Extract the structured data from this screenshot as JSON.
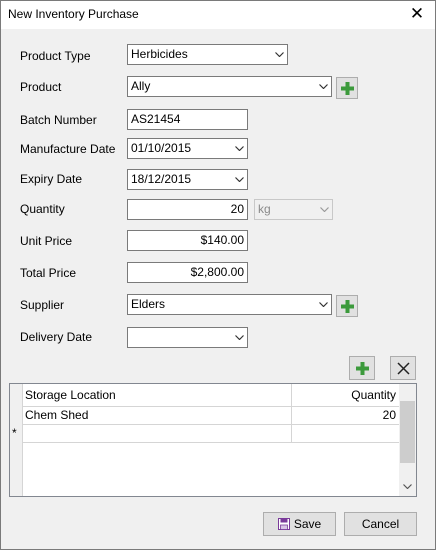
{
  "window": {
    "title": "New Inventory Purchase"
  },
  "form": {
    "product_type_label": "Product Type",
    "product_type_value": "Herbicides",
    "product_label": "Product",
    "product_value": "Ally",
    "batch_label": "Batch Number",
    "batch_value": "AS21454",
    "manufacture_label": "Manufacture Date",
    "manufacture_value": "01/10/2015",
    "expiry_label": "Expiry Date",
    "expiry_value": "18/12/2015",
    "quantity_label": "Quantity",
    "quantity_value": "20",
    "unit_value": "kg",
    "unit_price_label": "Unit Price",
    "unit_price_value": "$140.00",
    "total_price_label": "Total Price",
    "total_price_value": "$2,800.00",
    "supplier_label": "Supplier",
    "supplier_value": "Elders",
    "delivery_label": "Delivery Date",
    "delivery_value": ""
  },
  "grid": {
    "columns": [
      "Storage Location",
      "Quantity"
    ],
    "rows": [
      {
        "location": "Chem Shed",
        "quantity": "20"
      }
    ],
    "new_row_marker": "*"
  },
  "buttons": {
    "save": "Save",
    "cancel": "Cancel"
  },
  "colors": {
    "plus_green": "#3c9a3c",
    "save_purple": "#7a3a9a"
  }
}
